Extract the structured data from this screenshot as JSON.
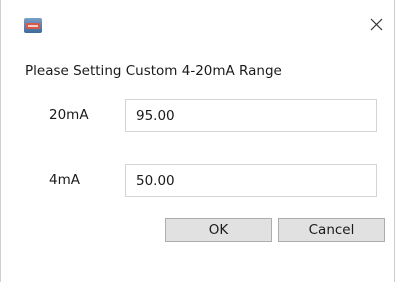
{
  "window": {
    "icon": "app-icon",
    "close_glyph": "✕"
  },
  "dialog": {
    "prompt": "Please Setting Custom 4-20mA Range",
    "fields": [
      {
        "label": "20mA",
        "value": "95.00"
      },
      {
        "label": "4mA",
        "value": "50.00"
      }
    ],
    "ok_label": "OK",
    "cancel_label": "Cancel"
  },
  "colors": {
    "button_face": "#e1e1e1",
    "button_border": "#adadad",
    "input_border": "#d4d4d4"
  }
}
